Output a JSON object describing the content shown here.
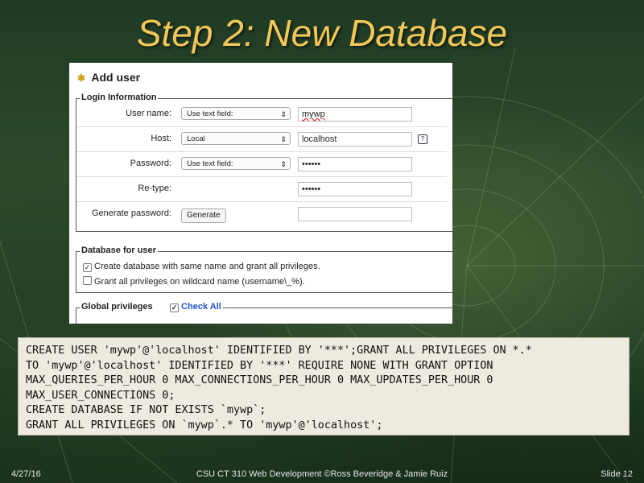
{
  "slide": {
    "title": "Step 2: New Database",
    "footer_date": "4/27/16",
    "footer_center": "CSU CT 310 Web Development ©Ross Beveridge & Jamie Ruiz",
    "footer_slide": "Slide 12"
  },
  "panel": {
    "header": "Add user",
    "header_icon": "add-user-icon",
    "login_legend": "Login Information",
    "fields": [
      {
        "label": "User name:",
        "select": "Use text field:",
        "value": "mywp"
      },
      {
        "label": "Host:",
        "select": "Local",
        "value": "localhost"
      },
      {
        "label": "Password:",
        "select": "Use text field:",
        "value": "••••••"
      },
      {
        "label": "Re-type:",
        "select": "",
        "value": "••••••"
      },
      {
        "label": "Generate password:",
        "button": "Generate",
        "value": ""
      }
    ],
    "help_icon": "help-icon",
    "db_legend": "Database for user",
    "db_options": [
      {
        "label": "Create database with same name and grant all privileges.",
        "checked": true
      },
      {
        "label": "Grant all privileges on wildcard name (username\\_%).",
        "checked": false
      }
    ],
    "global_legend": "Global privileges",
    "check_all": "Check All"
  },
  "sql": {
    "lines": [
      "CREATE USER 'mywp'@'localhost' IDENTIFIED BY '***';GRANT ALL PRIVILEGES ON *.*",
      "TO 'mywp'@'localhost' IDENTIFIED BY '***' REQUIRE NONE WITH GRANT OPTION",
      "MAX_QUERIES_PER_HOUR 0 MAX_CONNECTIONS_PER_HOUR 0 MAX_UPDATES_PER_HOUR 0",
      "MAX_USER_CONNECTIONS 0;",
      "CREATE DATABASE IF NOT EXISTS `mywp`;",
      "GRANT ALL PRIVILEGES ON `mywp`.* TO 'mywp'@'localhost';"
    ]
  },
  "colors": {
    "title": "#f2c75a",
    "link": "#2255cc",
    "sql_bg": "#eeeadf"
  }
}
